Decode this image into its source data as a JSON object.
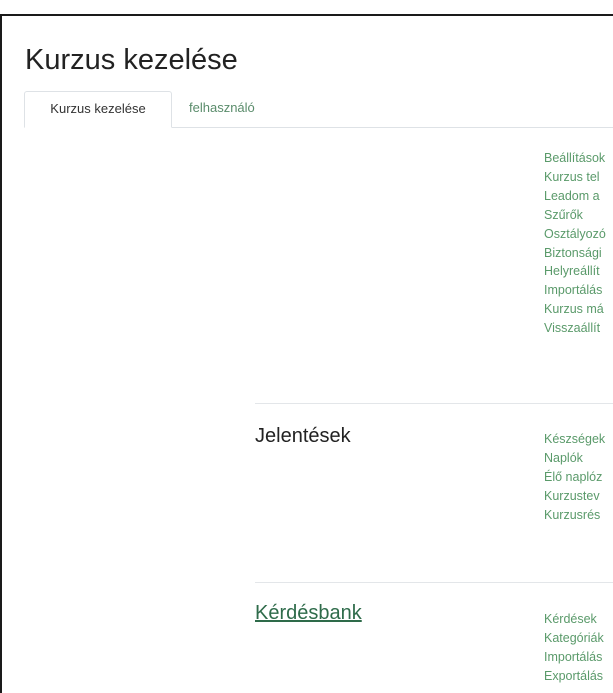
{
  "page": {
    "title": "Kurzus kezelése"
  },
  "tabs": [
    {
      "label": "Kurzus kezelése",
      "active": true
    },
    {
      "label": "felhasználó",
      "active": false
    }
  ],
  "sections": [
    {
      "heading": "",
      "links": [
        "Beállítások",
        "Kurzus tel",
        "Leadom a",
        "Szűrők",
        "Osztályozó",
        "Biztonsági",
        "Helyreállít",
        "Importálás",
        "Kurzus má",
        "Visszaállít"
      ]
    },
    {
      "heading": "Jelentések",
      "links": [
        "Készségek",
        "Naplók",
        "Élő naplóz",
        "Kurzustev",
        "Kurzusrés"
      ]
    },
    {
      "heading": "Kérdésbank",
      "links": [
        "Kérdések",
        "Kategóriák",
        "Importálás",
        "Exportálás"
      ]
    }
  ],
  "colors": {
    "link": "#5a9a6a",
    "heading_link": "#2e6b4a",
    "border": "#dee2e6"
  }
}
